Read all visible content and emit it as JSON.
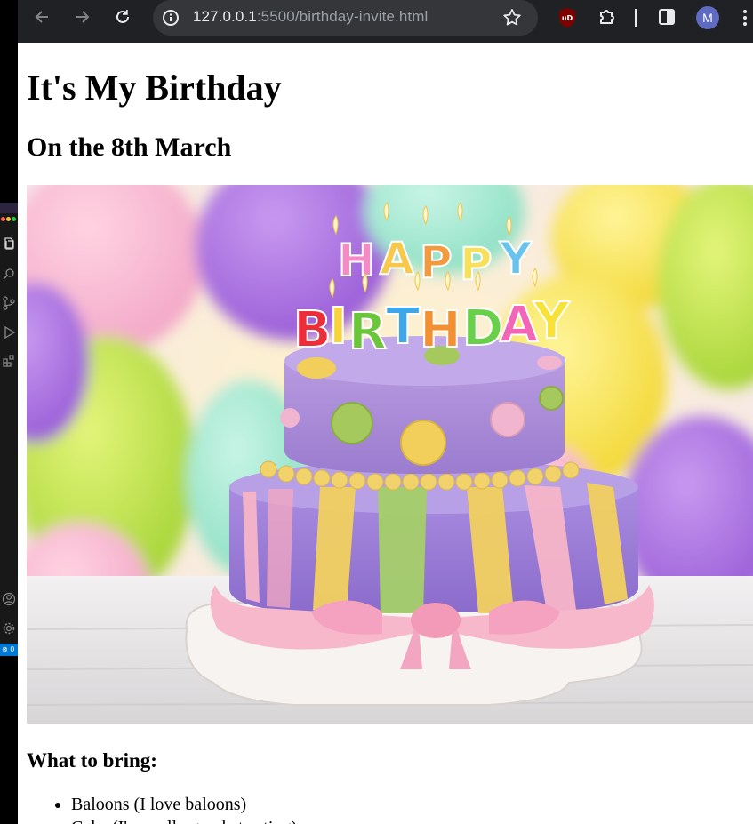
{
  "browser": {
    "url_host": "127.0.0.1",
    "url_rest": ":5500/birthday-invite.html",
    "profile_initial": "M",
    "icons": {
      "back": "arrow-left-icon",
      "forward": "arrow-right-icon",
      "reload": "reload-icon",
      "info": "info-icon",
      "bookmark": "star-icon",
      "ublock": "ublock-origin-icon",
      "extensions": "puzzle-icon",
      "side_panel": "side-panel-icon",
      "menu": "kebab-menu-icon"
    }
  },
  "editor_strip": {
    "status_text": "⊗ 0",
    "icons": [
      "explorer-icon",
      "search-icon",
      "source-control-icon",
      "run-debug-icon",
      "extensions-icon",
      "account-icon",
      "settings-gear-icon"
    ]
  },
  "page": {
    "title": "It's My Birthday",
    "date": "On the 8th March",
    "image": {
      "description_icon": "birthday-cake-image",
      "candle_letters": "HAPPY BIRTHDAY"
    },
    "bring_heading": "What to bring:",
    "bring_items": [
      "Baloons (I love baloons)",
      "Cake (I'm really good at eating)"
    ]
  },
  "colors": {
    "toolbar_bg": "#202124",
    "omnibox_bg": "#35363a",
    "avatar_bg": "#5f6bc2",
    "vscode_status": "#0078d4"
  }
}
